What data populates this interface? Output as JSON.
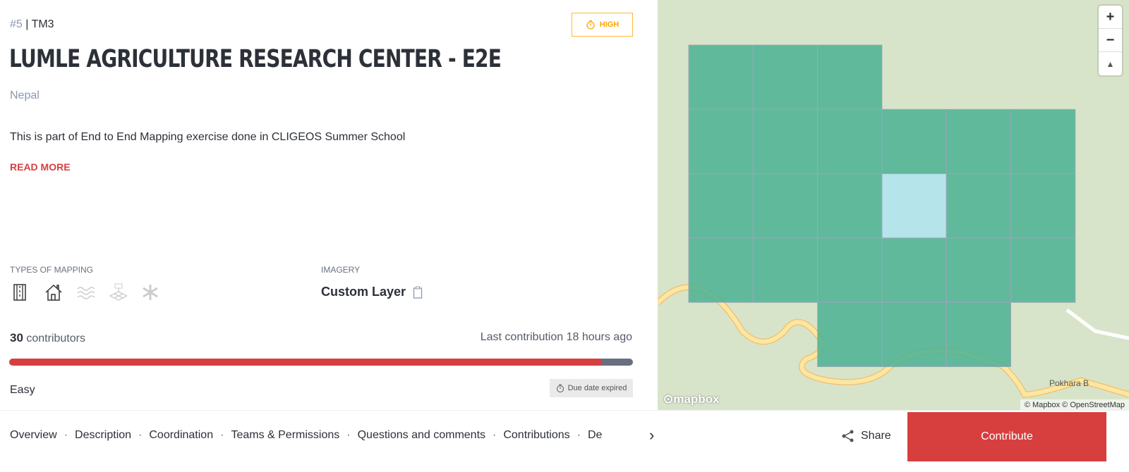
{
  "project": {
    "id": "#5",
    "org": "TM3",
    "priority": "HIGH",
    "title": "LUMLE AGRICULTURE RESEARCH CENTER - E2E",
    "country": "Nepal",
    "description": "This is part of End to End Mapping exercise done in CLIGEOS Summer School",
    "read_more": "READ MORE"
  },
  "types_of_mapping": {
    "label": "TYPES OF MAPPING",
    "icons": [
      {
        "name": "road-icon",
        "active": true
      },
      {
        "name": "building-icon",
        "active": true
      },
      {
        "name": "waterways-icon",
        "active": false
      },
      {
        "name": "land-use-icon",
        "active": false
      },
      {
        "name": "other-icon",
        "active": false
      }
    ]
  },
  "imagery": {
    "label": "IMAGERY",
    "value": "Custom Layer"
  },
  "stats": {
    "contributors_count": "30",
    "contributors_label": "contributors",
    "last_contribution": "Last contribution 18 hours ago",
    "progress_percent": 95,
    "difficulty": "Easy",
    "due": "Due date expired"
  },
  "map": {
    "zoom_in": "+",
    "zoom_out": "−",
    "compass": "▲",
    "logo": "mapbox",
    "attribution": "© Mapbox © OpenStreetMap",
    "road_label": "Pokhara B",
    "task_color": "#4fb394",
    "highlight_color": "#b5e4ea"
  },
  "nav": {
    "tabs": [
      "Overview",
      "Description",
      "Coordination",
      "Teams & Permissions",
      "Questions and comments",
      "Contributions",
      "De"
    ],
    "share": "Share",
    "contribute": "Contribute"
  },
  "colors": {
    "accent": "#d73f3f",
    "priority": "#ffa500"
  }
}
